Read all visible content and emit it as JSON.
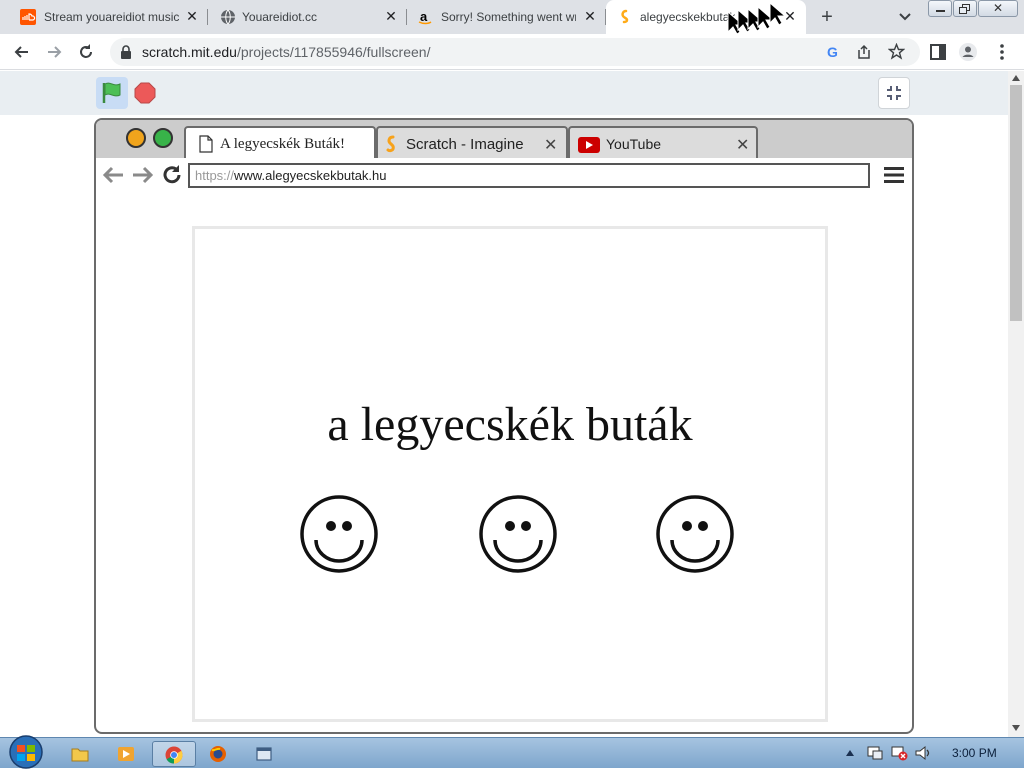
{
  "chrome_tabs": [
    {
      "title": "Stream youareidiot music",
      "favicon": "soundcloud-icon",
      "color": "#ff5500"
    },
    {
      "title": "Youareidiot.cc",
      "favicon": "globe-icon",
      "color": "#5f6368"
    },
    {
      "title": "Sorry! Something went wrong",
      "favicon": "amazon-icon",
      "color": "#000000"
    },
    {
      "title": "alegyecskekbutak",
      "favicon": "scratch-icon",
      "color": "#ffab19",
      "active": true
    }
  ],
  "chrome_toolbar": {
    "url_host": "scratch.mit.edu",
    "url_path": "/projects/117855946/fullscreen/"
  },
  "scratch": {
    "green_flag": "green-flag-icon",
    "stop": "stop-icon",
    "exit_fullscreen": "exit-fullscreen-icon"
  },
  "fake_browser": {
    "tabs": [
      {
        "title": "A legyecskék Buták!",
        "icon": "page-icon"
      },
      {
        "title": "Scratch - Imagine",
        "icon": "scratch-icon"
      },
      {
        "title": "YouTube",
        "icon": "youtube-icon"
      }
    ],
    "url_protocol": "https://",
    "url_host": "www.alegyecskekbutak.hu",
    "headline": "a legyecskék buták"
  },
  "taskbar": {
    "time": "3:00 PM"
  },
  "colors": {
    "scratch_orange": "#ffab19",
    "flag_green": "#4cbf56",
    "stop_red": "#ec5959",
    "taskbar_blue": "#8fb2d6"
  }
}
